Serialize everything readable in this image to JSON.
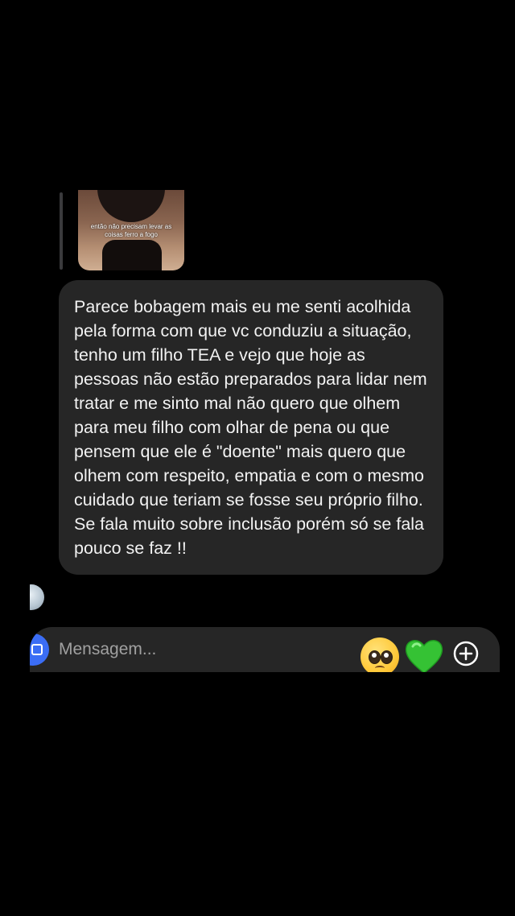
{
  "reply_preview": {
    "caption": "então não precisam levar as coisas ferro a fogo"
  },
  "message": {
    "text": "Parece bobagem mais eu me senti acolhida pela forma com que vc conduziu a situação, tenho um filho TEA e vejo que hoje as pessoas não estão preparados para lidar nem tratar e me sinto mal não quero que olhem para meu filho com olhar de pena ou que pensem que ele é \"doente\" mais quero que olhem com respeito, empatia e com o mesmo cuidado que teriam se fosse seu próprio filho. Se fala muito sobre inclusão porém só se fala pouco se faz !!"
  },
  "composer": {
    "placeholder": "Mensagem...",
    "emojis": [
      "pleading-face-emoji",
      "green-heart-emoji"
    ],
    "accent": "#3b6df5"
  },
  "icons": {
    "camera": "camera-icon",
    "add": "plus-circle-icon",
    "avatar": "avatar"
  }
}
